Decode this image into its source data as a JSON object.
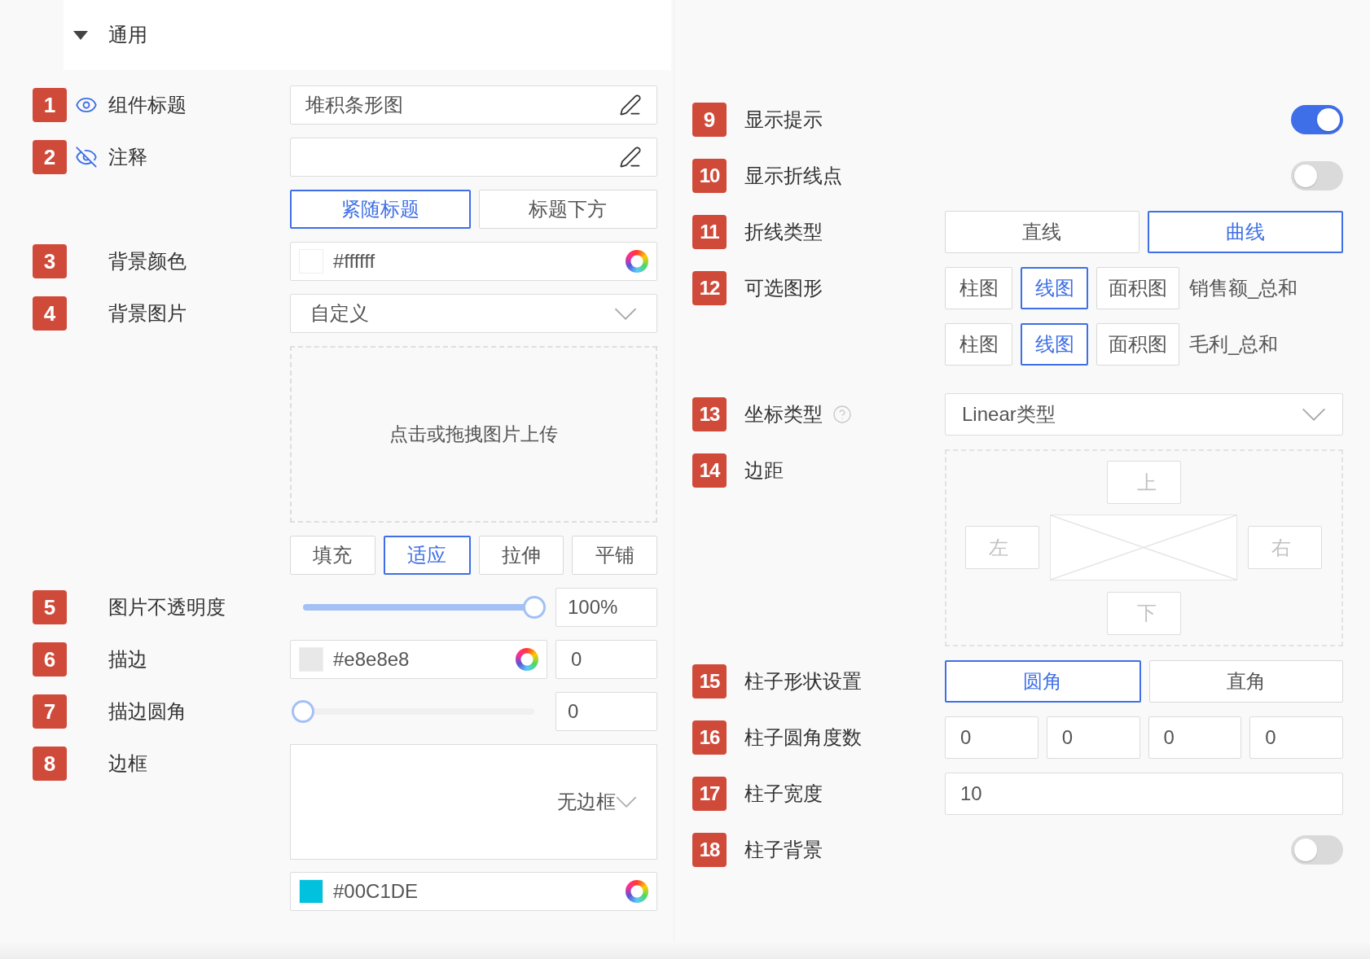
{
  "section": {
    "title": "通用",
    "expanded": true
  },
  "left_settings": [
    {
      "number": "1",
      "label": "组件标题",
      "visible": true,
      "kind": "text",
      "value": "堆积条形图"
    },
    {
      "number": "2",
      "label": "注释",
      "visible": false,
      "kind": "text",
      "options": [
        {
          "label": "紧随标题",
          "selected": true
        },
        {
          "label": "标题下方",
          "selected": false
        }
      ]
    },
    {
      "number": "3",
      "label": "背景颜色",
      "kind": "color",
      "value": "#ffffff"
    },
    {
      "number": "4",
      "label": "背景图片",
      "kind": "select",
      "value": "自定义",
      "upload_text": "点击或拖拽图片上传",
      "options": [
        {
          "label": "填充",
          "selected": false
        },
        {
          "label": "适应",
          "selected": true
        },
        {
          "label": "拉伸",
          "selected": false
        },
        {
          "label": "平铺",
          "selected": false
        }
      ]
    },
    {
      "number": "5",
      "label": "图片不透明度",
      "kind": "slider",
      "level": 1,
      "reading": "100%"
    },
    {
      "number": "6",
      "label": "描边",
      "kind": "color_number",
      "value": "#e8e8e8",
      "amount": "0"
    },
    {
      "number": "7",
      "label": "描边圆角",
      "kind": "slider",
      "level": 0,
      "reading": "0"
    },
    {
      "number": "8",
      "label": "边框",
      "kind": "border",
      "value": "无边框",
      "color_value": "#00C1DE"
    }
  ],
  "right_settings": [
    {
      "number": "9",
      "label": "显示提示",
      "kind": "toggle",
      "on": true
    },
    {
      "number": "10",
      "label": "显示折线点",
      "kind": "toggle",
      "on": false
    },
    {
      "number": "11",
      "label": "折线类型",
      "kind": "segmented",
      "options": [
        {
          "label": "直线",
          "selected": false
        },
        {
          "label": "曲线",
          "selected": true
        }
      ]
    },
    {
      "number": "12",
      "label": "可选图形",
      "kind": "chart_types",
      "series": [
        {
          "name": "销售额_总和",
          "options": [
            {
              "label": "柱图",
              "selected": false
            },
            {
              "label": "线图",
              "selected": true
            },
            {
              "label": "面积图",
              "selected": false
            }
          ]
        },
        {
          "name": "毛利_总和",
          "options": [
            {
              "label": "柱图",
              "selected": false
            },
            {
              "label": "线图",
              "selected": true
            },
            {
              "label": "面积图",
              "selected": false
            }
          ]
        }
      ]
    },
    {
      "number": "13",
      "label": "坐标类型",
      "kind": "select",
      "help": true,
      "value": "Linear类型"
    },
    {
      "number": "14",
      "label": "边距",
      "kind": "margin",
      "top": "上",
      "left": "左",
      "right": "右",
      "bottom": "下"
    },
    {
      "number": "15",
      "label": "柱子形状设置",
      "kind": "segmented",
      "options": [
        {
          "label": "圆角",
          "selected": true
        },
        {
          "label": "直角",
          "selected": false
        }
      ]
    },
    {
      "number": "16",
      "label": "柱子圆角度数",
      "kind": "numbers",
      "values": [
        "0",
        "0",
        "0",
        "0"
      ]
    },
    {
      "number": "17",
      "label": "柱子宽度",
      "kind": "text",
      "value": "10"
    },
    {
      "number": "18",
      "label": "柱子背景",
      "kind": "toggle",
      "on": false
    }
  ]
}
